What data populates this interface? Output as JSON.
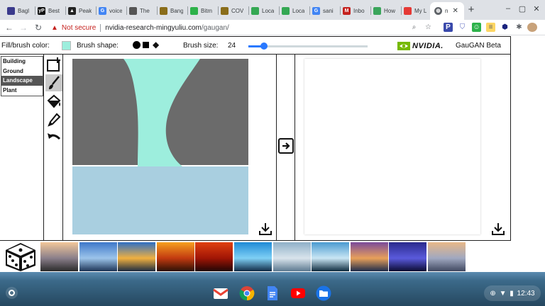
{
  "browser": {
    "tabs": [
      {
        "label": "Bagl",
        "favicon": "chat-icon",
        "color": "#3a3a8c"
      },
      {
        "label": "Best",
        "favicon": "yelp-icon",
        "color": "#111111",
        "glyph": "yP"
      },
      {
        "label": "Peak",
        "favicon": "peak-icon",
        "color": "#222222",
        "glyph": "▲"
      },
      {
        "label": "voice",
        "favicon": "google-icon",
        "color": "#4285f4",
        "glyph": "G"
      },
      {
        "label": "The",
        "favicon": "panda-icon",
        "color": "#555555"
      },
      {
        "label": "Bang",
        "favicon": "bang-icon",
        "color": "#8a6d1a"
      },
      {
        "label": "Bitm",
        "favicon": "bitmoji-icon",
        "color": "#2db24a"
      },
      {
        "label": "COV",
        "favicon": "cov-icon",
        "color": "#8a6d1a"
      },
      {
        "label": "Loca",
        "favicon": "maps-icon",
        "color": "#34a853"
      },
      {
        "label": "Loca",
        "favicon": "maps-icon",
        "color": "#34a853"
      },
      {
        "label": "sani",
        "favicon": "google-icon",
        "color": "#4285f4",
        "glyph": "G"
      },
      {
        "label": "Inbo",
        "favicon": "gmail-icon",
        "color": "#c5221f",
        "glyph": "M"
      },
      {
        "label": "How",
        "favicon": "leaf-icon",
        "color": "#3aa55b"
      },
      {
        "label": "My L",
        "favicon": "youtube-icon",
        "color": "#e53935"
      }
    ],
    "active_tab": {
      "label": "n",
      "favicon": "globe-icon"
    },
    "url": {
      "warning": "Not secure",
      "host": "nvidia-research-mingyuliu.com",
      "path": "/gaugan/"
    }
  },
  "app": {
    "fill_label": "Fill/brush color:",
    "fill_color": "#9deedd",
    "shape_label": "Brush shape:",
    "size_label": "Brush size:",
    "brush_size": "24",
    "brush_size_fraction": 0.13,
    "brand": "NVIDIA.",
    "title": "GauGAN Beta",
    "labels": [
      "Building",
      "Ground",
      "Landscape",
      "Plant"
    ],
    "selected_label": "Landscape",
    "tools": [
      "new-canvas-icon",
      "brush-icon",
      "fill-bucket-icon",
      "eyedropper-icon",
      "undo-icon"
    ],
    "selected_tool": "brush-icon",
    "segmentation_colors": {
      "rock": "#6b6b6b",
      "water": "#9deedd",
      "sea": "#a9cfe0"
    }
  },
  "styles": {
    "thumbnails": [
      {
        "colors": [
          "#f3c79a",
          "#8a7f8a",
          "#2a2a2a"
        ]
      },
      {
        "colors": [
          "#3e78c9",
          "#9cc4ea",
          "#1c3355"
        ]
      },
      {
        "colors": [
          "#2d6fc4",
          "#f0b040",
          "#1a2a40"
        ]
      },
      {
        "colors": [
          "#f6a020",
          "#c23a10",
          "#2a1005"
        ]
      },
      {
        "colors": [
          "#e04010",
          "#a01505",
          "#200505"
        ]
      },
      {
        "colors": [
          "#1e8ad6",
          "#7fd0f5",
          "#102a45"
        ]
      },
      {
        "colors": [
          "#8fb0c8",
          "#d9e4ec",
          "#5b7890"
        ]
      },
      {
        "colors": [
          "#4a9bd0",
          "#c9e6f4",
          "#0d2a3d"
        ]
      },
      {
        "colors": [
          "#7a4a9a",
          "#e8a05a",
          "#1c2a4a"
        ]
      },
      {
        "colors": [
          "#2a2a8c",
          "#5a5adc",
          "#0a0a30"
        ]
      },
      {
        "colors": [
          "#e8b888",
          "#a0a8c0",
          "#404860"
        ]
      }
    ]
  },
  "shelf": {
    "apps": [
      "gmail-icon",
      "chrome-icon",
      "docs-icon",
      "youtube-icon",
      "files-icon"
    ],
    "time": "12:43"
  }
}
